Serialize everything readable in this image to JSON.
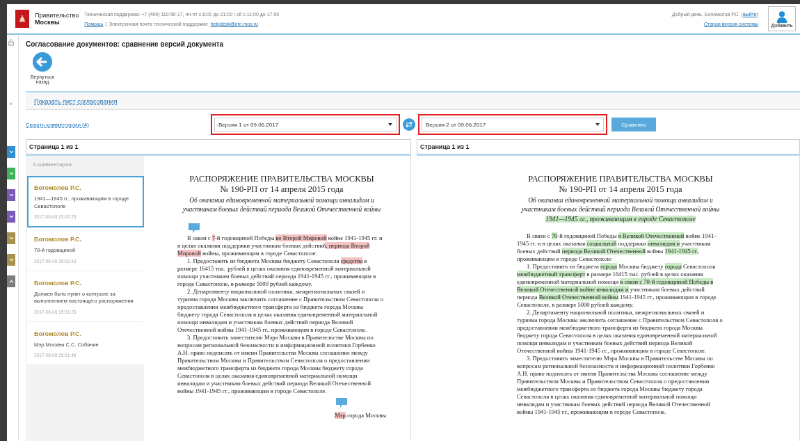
{
  "header": {
    "org_line1": "Правительство",
    "org_line2": "Москвы",
    "support": "Техническая поддержка: +7 (499) 110-50-17, пн-пт с 8:00 до 21:00 / сб с 11:00 до 17:00",
    "help_link": "Помощь",
    "separator": "|",
    "email_label": "Электронная почта технической поддержки:",
    "email_link": "helpdesk@em.mos.ru",
    "greeting_before": "Добрый день, Боломолов Р.С. (",
    "logout_link": "выйти",
    "greeting_after": ")",
    "old_version_link": "Старая версия системы",
    "user_button": "Добавить"
  },
  "sidebar": {
    "collapse": "«"
  },
  "side_markers": [
    {
      "color": "#2f8fd0",
      "kind": "down"
    },
    {
      "color": "#3cb35a",
      "kind": "down"
    },
    {
      "color": "#7a59b8",
      "kind": "down"
    },
    {
      "color": "#7a59b8",
      "kind": "down"
    },
    {
      "color": "#a8914a",
      "kind": "down"
    },
    {
      "color": "#a8914a",
      "kind": "down"
    },
    {
      "color": "#7d7d7d",
      "kind": "up"
    }
  ],
  "page_title": "Согласование документов: сравнение версий документа",
  "back_button": "Вернуться назад",
  "show_approval_link": "Показать лист согласования",
  "hide_comments_link": "Скрыть комментарии (4)",
  "version_left": {
    "value": "Версия 1 от 09.06.2017",
    "highlighted": true
  },
  "version_right": {
    "value": "Версия 2 от 09.06.2017",
    "highlighted": true
  },
  "compare_button": "Сравнить",
  "comments": {
    "count": "4 комментария",
    "items": [
      {
        "author": "Богомолов Р.С.",
        "text": "1941—1945 гг., проживающим в городе Севастополе",
        "time": "2017-06-09 15:00:25",
        "selected": true
      },
      {
        "author": "Богомолов Р.С.",
        "text": "70-й годовщиной",
        "time": "2017-06-09 15:00:43",
        "selected": false
      },
      {
        "author": "Богомолов Р.С.",
        "text": "Должен быть пункт о контроле за выполнением настоящего распоряжения",
        "time": "2017-06-09 15:01:23",
        "selected": false
      },
      {
        "author": "Богомолов Р.С.",
        "text": "Мэр Москвы С.С. Собянин",
        "time": "2017-06-09 15:01:46",
        "selected": false
      }
    ]
  },
  "documents": [
    {
      "page_label": "Страница 1 из 1",
      "title": "РАСПОРЯЖЕНИЕ ПРАВИТЕЛЬСТВА МОСКВЫ",
      "number": "№ 190-РП от 14 апреля 2015 года",
      "subtitle": [
        {
          "text": "Об оказании единовременной материальной помощи инвалидам и участникам боевых действий периода Великой Отечественной войны",
          "changed": false
        }
      ],
      "paragraphs": [
        {
          "kind": "body",
          "bubble": true,
          "segments": [
            {
              "text": "В связи с ",
              "changed": false
            },
            {
              "text": "7",
              "changed": true
            },
            {
              "text": "-й годовщиной Победы ",
              "changed": false
            },
            {
              "text": "во Второй Мировой",
              "changed": true
            },
            {
              "text": " войне 1941-1945 гг. и в целях оказания поддержки участникам боевых действий",
              "changed": false
            },
            {
              "text": ", периода Второй Мировой",
              "changed": true
            },
            {
              "text": " войны, проживающим в городе Севастополе:",
              "changed": false
            }
          ]
        },
        {
          "kind": "body",
          "bubble": false,
          "segments": [
            {
              "text": "1. Предоставить из бюджета Москвы бюджету Севастополя ",
              "changed": false
            },
            {
              "text": "средства",
              "changed": true
            },
            {
              "text": " в размере 16415 тыс. рублей в целях оказания единовременной материальной помощи участникам боевых действий периода 1941-1945 гг., проживающим в городе Севастополе, в размере 5000 рублей каждому.",
              "changed": false
            }
          ]
        },
        {
          "kind": "body",
          "bubble": false,
          "segments": [
            {
              "text": "2. Департаменту национальной политики, межрегиональных связей и туризма города Москвы заключить соглашение с Правительством Севастополя о предоставлении межбюджетного трансферта из бюджета города Москвы бюджету города Севастополя в целях оказания единовременной материальной помощи инвалидам и участникам боевых действий периода Великой Отечественной войны 1941-1945 гг., проживающим в городе Севастополе.",
              "changed": false
            }
          ]
        },
        {
          "kind": "body",
          "bubble": false,
          "segments": [
            {
              "text": "3. Предоставить заместителю Мэра Москвы в Правительстве Москвы по вопросам региональной безопасности и информационной политики Горбенко А.Н. право подписать от имени Правительства Москвы соглашение между Правительством Москвы и Правительством Севастополя о предоставлении межбюджетного трансферта из бюджета города Москвы бюджету города Севастополя в целях оказания единовременной материальной помощи инвалидам и участникам боевых действий периода Великой Отечественной войны 1941-1945 гг., проживающим в городе Севастополе.",
              "changed": false
            }
          ]
        },
        {
          "kind": "signature",
          "bubble": true,
          "segments": [
            {
              "text": "Мэр",
              "changed": true
            },
            {
              "text": " города Москвы",
              "changed": false
            }
          ]
        }
      ]
    },
    {
      "page_label": "Страница 1 из 1",
      "title": "РАСПОРЯЖЕНИЕ ПРАВИТЕЛЬСТВА МОСКВЫ",
      "number": "№ 190-РП от 14 апреля 2015 года",
      "subtitle": [
        {
          "text": "Об оказании единовременной материальной помощи инвалидам и участникам боевых действий периода Великой Отечественной войны ",
          "changed": false
        },
        {
          "text": "1941—1945 гг., проживающим в городе Севастополе",
          "changed": true
        }
      ],
      "paragraphs": [
        {
          "kind": "body",
          "bubble": false,
          "segments": [
            {
              "text": "В связи с ",
              "changed": false
            },
            {
              "text": "70",
              "changed": true
            },
            {
              "text": "-й годовщиной Победы ",
              "changed": false
            },
            {
              "text": "в Великой Отечественной",
              "changed": true
            },
            {
              "text": " войне 1941-1945 гг. и в целях оказания ",
              "changed": false
            },
            {
              "text": "социальной",
              "changed": true
            },
            {
              "text": " поддержки ",
              "changed": false
            },
            {
              "text": "инвалидам и",
              "changed": true
            },
            {
              "text": " участникам боевых действий ",
              "changed": false
            },
            {
              "text": "периода Великой Отечественной",
              "changed": true
            },
            {
              "text": " войны ",
              "changed": false
            },
            {
              "text": "1941-1945 гг.",
              "changed": true
            },
            {
              "text": ", проживающим в городе Севастополе:",
              "changed": false
            }
          ]
        },
        {
          "kind": "body",
          "bubble": false,
          "segments": [
            {
              "text": "1. Предоставить из бюджета ",
              "changed": false
            },
            {
              "text": "города",
              "changed": true
            },
            {
              "text": " Москвы бюджету ",
              "changed": false
            },
            {
              "text": "города",
              "changed": true
            },
            {
              "text": " Севастополя ",
              "changed": false
            },
            {
              "text": "межбюджетный трансферт",
              "changed": true
            },
            {
              "text": " в размере 16415 тыс. рублей в целях оказания единовременной материальной помощи ",
              "changed": false
            },
            {
              "text": "в связи с 70-й годовщиной Победы в Великой Отечественной войне инвалидам и",
              "changed": true
            },
            {
              "text": " участникам боевых действий периода ",
              "changed": false
            },
            {
              "text": "Великой Отечественной войны",
              "changed": true
            },
            {
              "text": " 1941-1945 гг., проживающим в городе Севастополе, в размере 5000 рублей каждому.",
              "changed": false
            }
          ]
        },
        {
          "kind": "body",
          "bubble": false,
          "segments": [
            {
              "text": "2. Департаменту национальной политики, межрегиональных связей и туризма города Москвы заключить соглашение с Правительством Севастополя о предоставлении межбюджетного трансферта из бюджета города Москвы бюджету города Севастополя в целях оказания единовременной материальной помощи инвалидам и участникам боевых действий периода Великой Отечественной войны 1941-1945 гг., проживающим в городе Севастополе.",
              "changed": false
            }
          ]
        },
        {
          "kind": "body",
          "bubble": false,
          "segments": [
            {
              "text": "3. Предоставить заместителю Мэра Москвы в Правительстве Москвы по вопросам региональной безопасности и информационной политики Горбенко А.Н. право подписать от имени Правительства Москвы соглашение между Правительством Москвы и Правительством Севастополя о предоставлении межбюджетного трансферта из бюджета города Москвы бюджету города Севастополя в целях оказания единовременной материальной помощи инвалидам и участникам боевых действий периода Великой Отечественной войны 1941-1945 гг., проживающим в городе Севастополе.",
              "changed": false
            }
          ]
        }
      ]
    }
  ]
}
